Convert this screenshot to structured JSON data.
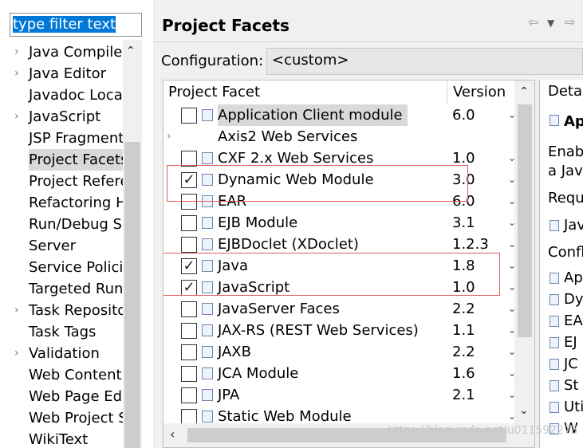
{
  "filter": {
    "text": "type filter text"
  },
  "nav": {
    "items": [
      {
        "label": "Java Compiler",
        "chevron": true
      },
      {
        "label": "Java Editor",
        "chevron": true
      },
      {
        "label": "Javadoc Location",
        "chevron": false
      },
      {
        "label": "JavaScript",
        "chevron": true
      },
      {
        "label": "JSP Fragment",
        "chevron": false
      },
      {
        "label": "Project Facets",
        "chevron": false,
        "selected": true
      },
      {
        "label": "Project References",
        "chevron": false
      },
      {
        "label": "Refactoring History",
        "chevron": false
      },
      {
        "label": "Run/Debug Settings",
        "chevron": false
      },
      {
        "label": "Server",
        "chevron": false
      },
      {
        "label": "Service Policies",
        "chevron": false
      },
      {
        "label": "Targeted Runtimes",
        "chevron": false
      },
      {
        "label": "Task Repository",
        "chevron": true
      },
      {
        "label": "Task Tags",
        "chevron": false
      },
      {
        "label": "Validation",
        "chevron": true
      },
      {
        "label": "Web Content Settings",
        "chevron": false
      },
      {
        "label": "Web Page Editor",
        "chevron": false
      },
      {
        "label": "Web Project Settings",
        "chevron": false
      },
      {
        "label": "WikiText",
        "chevron": false
      }
    ]
  },
  "page": {
    "title": "Project Facets",
    "configuration_label": "Configuration:",
    "configuration_value": "<custom>"
  },
  "table": {
    "col_facet": "Project Facet",
    "col_version": "Version",
    "rows": [
      {
        "name": "Application Client module",
        "version": "6.0",
        "checked": false,
        "selected": true
      },
      {
        "name": "Axis2 Web Services",
        "version": "",
        "checked": false,
        "group": true
      },
      {
        "name": "CXF 2.x Web Services",
        "version": "1.0",
        "checked": false
      },
      {
        "name": "Dynamic Web Module",
        "version": "3.0",
        "checked": true
      },
      {
        "name": "EAR",
        "version": "6.0",
        "checked": false
      },
      {
        "name": "EJB Module",
        "version": "3.1",
        "checked": false
      },
      {
        "name": "EJBDoclet (XDoclet)",
        "version": "1.2.3",
        "checked": false
      },
      {
        "name": "Java",
        "version": "1.8",
        "checked": true
      },
      {
        "name": "JavaScript",
        "version": "1.0",
        "checked": true
      },
      {
        "name": "JavaServer Faces",
        "version": "2.2",
        "checked": false
      },
      {
        "name": "JAX-RS (REST Web Services)",
        "version": "1.1",
        "checked": false
      },
      {
        "name": "JAXB",
        "version": "2.2",
        "checked": false
      },
      {
        "name": "JCA Module",
        "version": "1.6",
        "checked": false
      },
      {
        "name": "JPA",
        "version": "2.1",
        "checked": false
      },
      {
        "name": "Static Web Module",
        "version": "",
        "checked": false
      }
    ]
  },
  "details": {
    "tab": "Details",
    "heading": "Ap",
    "desc1": "Enab",
    "desc2": "a Java",
    "requires": "Requ",
    "req_item": "Jav",
    "conflicts": "Confl",
    "conflict_items": [
      "Ap",
      "Dy",
      "EA",
      "EJ",
      "JC",
      "St",
      "Uti",
      "W"
    ]
  },
  "watermark": "https://blog.csdn.net/u011592273"
}
